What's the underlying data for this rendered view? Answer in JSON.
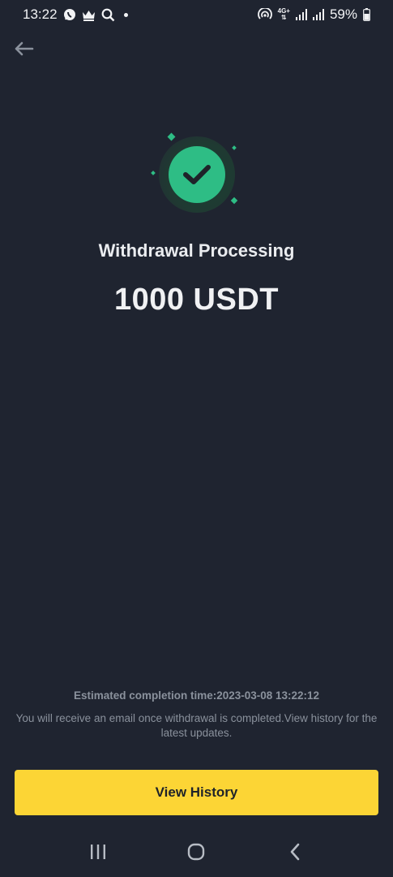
{
  "status_bar": {
    "time": "13:22",
    "network_label_top": "4G+",
    "network_label_bottom": "⇅",
    "battery": "59%"
  },
  "nav": {
    "back_icon": "arrow-left-icon"
  },
  "result": {
    "status_title": "Withdrawal Processing",
    "amount": "1000 USDT",
    "accent_color": "#2ebd85"
  },
  "footer": {
    "estimated_time": "Estimated completion time:2023-03-08 13:22:12",
    "info_text": "You will receive an email once withdrawal is completed.View history for the latest updates.",
    "view_history_label": "View History",
    "button_color": "#fcd535"
  },
  "system_nav": {
    "recents_icon": "recents-icon",
    "home_icon": "home-icon",
    "back_icon": "back-chevron-icon"
  }
}
